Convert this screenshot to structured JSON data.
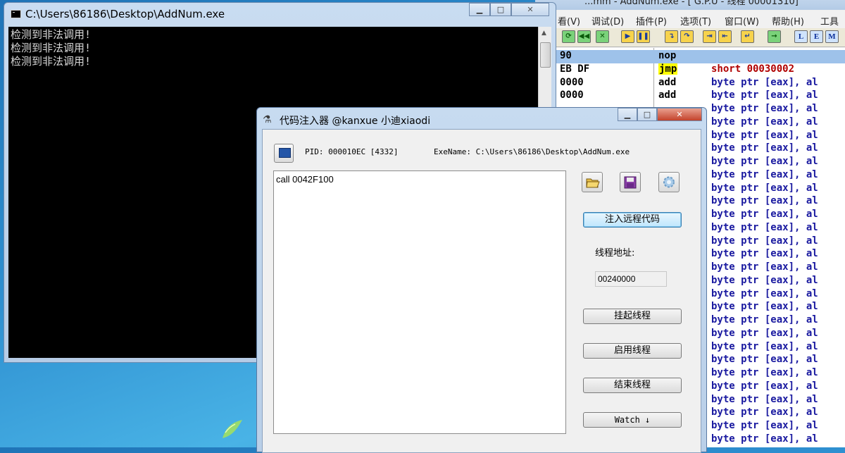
{
  "debugger": {
    "title": "...mm - AddNum.exe - [ G.P.U - 线程 00001310]",
    "menu": [
      "看(V)",
      "调试(D)",
      "插件(P)",
      "选项(T)",
      "窗口(W)",
      "帮助(H)",
      "工具"
    ],
    "toolbar_letters": [
      "L",
      "E",
      "M"
    ],
    "code_lines": [
      {
        "hex": "90",
        "mnemonic": "nop",
        "operand": ""
      },
      {
        "hex": "EB DF",
        "mnemonic": "jmp",
        "operand": "short 00030002"
      },
      {
        "hex": "0000",
        "mnemonic": "add",
        "operand": "byte ptr [eax], al"
      },
      {
        "hex": "0000",
        "mnemonic": "add",
        "operand": "byte ptr [eax], al"
      },
      {
        "hex": "",
        "mnemonic": "",
        "operand": "byte ptr [eax], al"
      },
      {
        "hex": "",
        "mnemonic": "",
        "operand": "byte ptr [eax], al"
      },
      {
        "hex": "",
        "mnemonic": "",
        "operand": "byte ptr [eax], al"
      },
      {
        "hex": "",
        "mnemonic": "",
        "operand": "byte ptr [eax], al"
      },
      {
        "hex": "",
        "mnemonic": "",
        "operand": "byte ptr [eax], al"
      },
      {
        "hex": "",
        "mnemonic": "",
        "operand": "byte ptr [eax], al"
      },
      {
        "hex": "",
        "mnemonic": "",
        "operand": "byte ptr [eax], al"
      },
      {
        "hex": "",
        "mnemonic": "",
        "operand": "byte ptr [eax], al"
      },
      {
        "hex": "",
        "mnemonic": "",
        "operand": "byte ptr [eax], al"
      },
      {
        "hex": "",
        "mnemonic": "",
        "operand": "byte ptr [eax], al"
      },
      {
        "hex": "",
        "mnemonic": "",
        "operand": "byte ptr [eax], al"
      },
      {
        "hex": "",
        "mnemonic": "",
        "operand": "byte ptr [eax], al"
      },
      {
        "hex": "",
        "mnemonic": "",
        "operand": "byte ptr [eax], al"
      },
      {
        "hex": "",
        "mnemonic": "",
        "operand": "byte ptr [eax], al"
      },
      {
        "hex": "",
        "mnemonic": "",
        "operand": "byte ptr [eax], al"
      },
      {
        "hex": "",
        "mnemonic": "",
        "operand": "byte ptr [eax], al"
      },
      {
        "hex": "",
        "mnemonic": "",
        "operand": "byte ptr [eax], al"
      },
      {
        "hex": "",
        "mnemonic": "",
        "operand": "byte ptr [eax], al"
      },
      {
        "hex": "",
        "mnemonic": "",
        "operand": "byte ptr [eax], al"
      },
      {
        "hex": "",
        "mnemonic": "",
        "operand": "byte ptr [eax], al"
      },
      {
        "hex": "",
        "mnemonic": "",
        "operand": "byte ptr [eax], al"
      },
      {
        "hex": "",
        "mnemonic": "",
        "operand": "byte ptr [eax], al"
      },
      {
        "hex": "",
        "mnemonic": "",
        "operand": "byte ptr [eax], al"
      },
      {
        "hex": "",
        "mnemonic": "",
        "operand": "byte ptr [eax], al"
      },
      {
        "hex": "",
        "mnemonic": "",
        "operand": "byte ptr [eax], al"
      },
      {
        "hex": "",
        "mnemonic": "",
        "operand": "byte ptr [eax], al"
      }
    ]
  },
  "console": {
    "title": "C:\\Users\\86186\\Desktop\\AddNum.exe",
    "lines": [
      "检测到非法调用!",
      "检测到非法调用!",
      "检测到非法调用!"
    ]
  },
  "injector": {
    "title": "代码注入器 @kanxue 小迪xiaodi",
    "pid_label": "PID:  000010EC [4332]",
    "exe_label": "ExeName:  C:\\Users\\86186\\Desktop\\AddNum.exe",
    "code": "call 0042F100",
    "inject_button": "注入远程代码",
    "thread_address_label": "线程地址:",
    "thread_address_value": "00240000",
    "suspend_button": "挂起线程",
    "resume_button": "启用线程",
    "terminate_button": "结束线程",
    "watch_button": "Watch ↓"
  },
  "colors": {
    "desktop": "#2e8fd0",
    "jmp_highlight": "#ffff00",
    "selected_row": "#9ec2ea",
    "operand_blue": "#1a1aa0",
    "operand_red": "#b00000"
  }
}
